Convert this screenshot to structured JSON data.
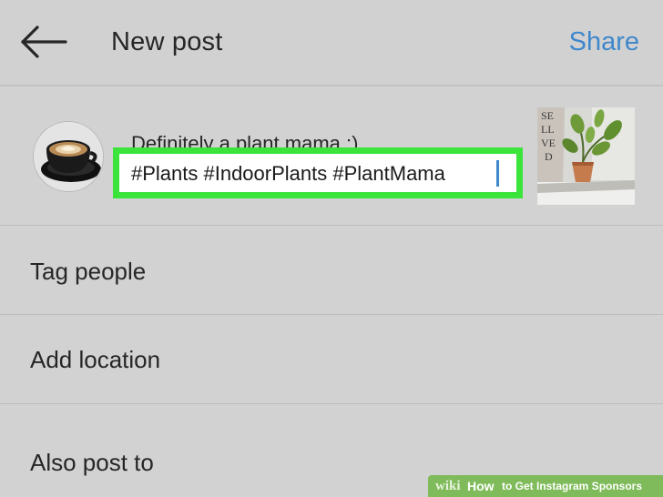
{
  "header": {
    "title": "New post",
    "share_label": "Share"
  },
  "compose": {
    "caption_line1": "Definitely a plant mama :)",
    "caption_line2": "#Plants #IndoorPlants #PlantMama",
    "thumbnail_text": "SE\nLL\nVE\nD"
  },
  "options": [
    {
      "label": "Tag people"
    },
    {
      "label": "Add location"
    },
    {
      "label": "Also post to"
    }
  ],
  "watermark": {
    "wiki": "wiki",
    "how": "How",
    "rest": "to Get Instagram Sponsors"
  },
  "colors": {
    "accent": "#3f88cc",
    "highlight": "#3be43b",
    "background": "#d2d2d2"
  }
}
